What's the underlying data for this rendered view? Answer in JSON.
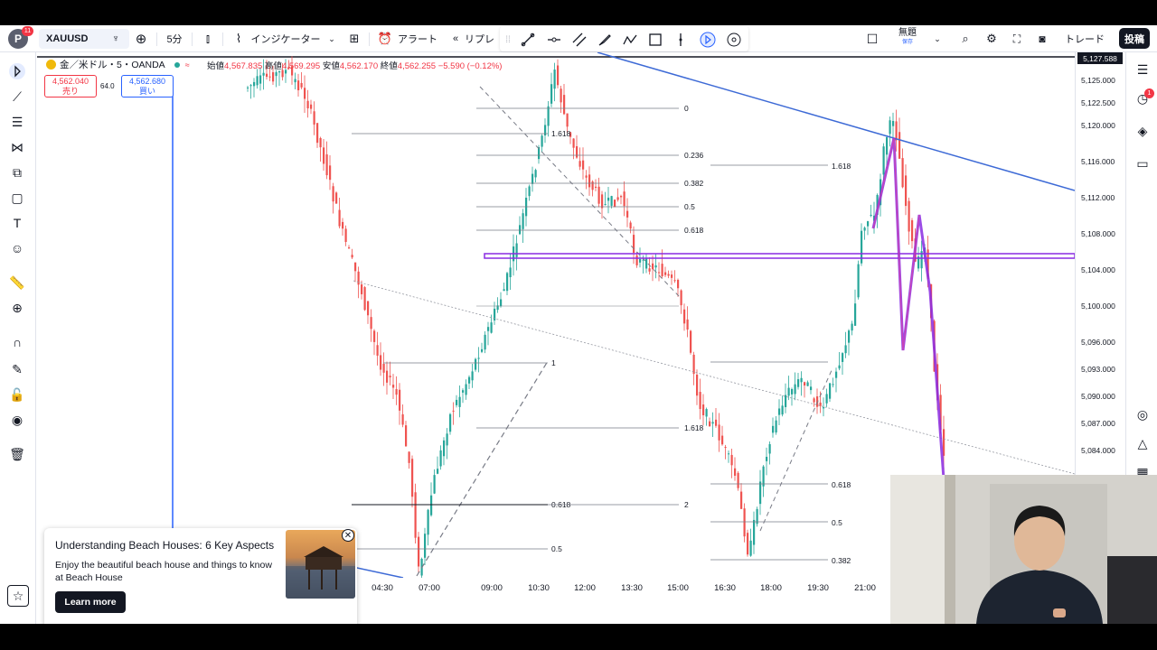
{
  "topbar": {
    "logo": "P",
    "logo_badge": "11",
    "symbol": "XAUUSD",
    "interval": "5分",
    "indicators_label": "インジケーター",
    "alert_label": "アラート",
    "replay_label": "リプレ",
    "layout_name": "無題",
    "layout_status": "保存",
    "trade_label": "トレード",
    "post_label": "投稿"
  },
  "legend": {
    "title": "金／米ドル・5・OANDA",
    "open_label": "始値",
    "open": "4,567.835",
    "high_label": "高値",
    "high": "4,569.295",
    "low_label": "安値",
    "low": "4,562.170",
    "close_label": "終値",
    "close": "4,562.255",
    "change": "−5.590 (−0.12%)",
    "sell_price": "4,562.040",
    "sell_label": "売り",
    "spread": "64.0",
    "buy_price": "4,562.680",
    "buy_label": "買い"
  },
  "price_axis": {
    "current_label": "5,127.588",
    "ticks": [
      "5,125.000",
      "5,122.500",
      "5,120.000",
      "5,116.000",
      "5,112.000",
      "5,108.000",
      "5,104.000",
      "5,100.000",
      "5,096.000",
      "5,093.000",
      "5,090.000",
      "5,087.000",
      "5,084.000"
    ]
  },
  "time_axis": {
    "ticks": [
      "04:30",
      "07:00",
      "09:00",
      "10:30",
      "12:00",
      "13:30",
      "15:00",
      "16:30",
      "18:00",
      "19:30",
      "21:00"
    ]
  },
  "fib_labels": {
    "a": [
      "0",
      "0.236",
      "0.382",
      "0.5",
      "0.618",
      "1.618"
    ],
    "a_top": "1.618",
    "b": [
      "0.618",
      "0.5",
      "0.382"
    ],
    "b2": "2",
    "b3": "1",
    "c": [
      "1.618",
      "0.618",
      "0.5",
      "0.382"
    ],
    "d": "1.618"
  },
  "ad": {
    "title": "Understanding Beach Houses: 6 Key Aspects",
    "body": "Enjoy the beautiful beach house and things to know at Beach House",
    "cta": "Learn more",
    "tag": "広告"
  },
  "colors": {
    "up": "#26a69a",
    "down": "#ef5350",
    "trend": "#3d6ad6",
    "purple": "#8a2be2",
    "fib": "#787b86"
  },
  "notifications": "1"
}
